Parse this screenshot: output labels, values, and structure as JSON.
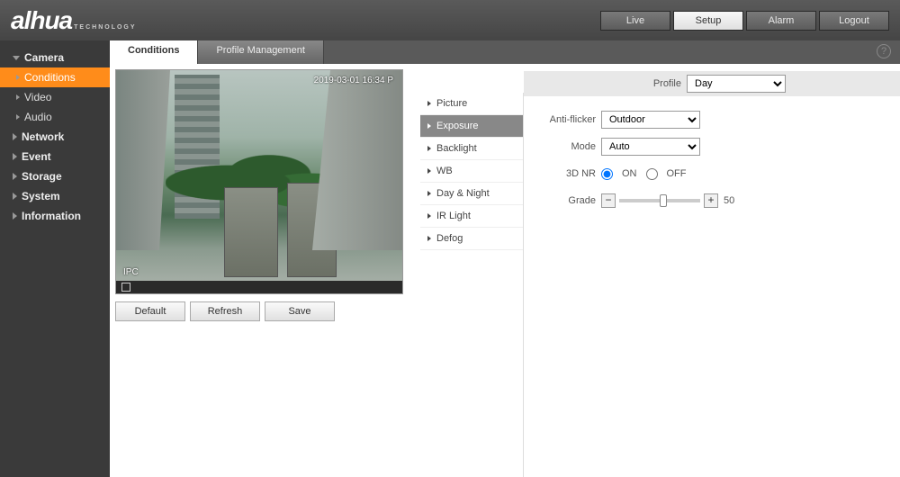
{
  "brand": {
    "name": "alhua",
    "sub": "TECHNOLOGY"
  },
  "topnav": {
    "live": "Live",
    "setup": "Setup",
    "alarm": "Alarm",
    "logout": "Logout"
  },
  "sidebar": {
    "camera": "Camera",
    "conditions": "Conditions",
    "video": "Video",
    "audio": "Audio",
    "network": "Network",
    "event": "Event",
    "storage": "Storage",
    "system": "System",
    "information": "Information"
  },
  "tabs": {
    "conditions": "Conditions",
    "profile_mgmt": "Profile Management"
  },
  "preview": {
    "timestamp": "2019-03-01 16:34 P",
    "label": "IPC"
  },
  "buttons": {
    "default": "Default",
    "refresh": "Refresh",
    "save": "Save"
  },
  "midmenu": {
    "picture": "Picture",
    "exposure": "Exposure",
    "backlight": "Backlight",
    "wb": "WB",
    "day_night": "Day & Night",
    "ir_light": "IR Light",
    "defog": "Defog"
  },
  "settings": {
    "profile_label": "Profile",
    "profile_value": "Day",
    "anti_flicker_label": "Anti-flicker",
    "anti_flicker_value": "Outdoor",
    "mode_label": "Mode",
    "mode_value": "Auto",
    "nr_label": "3D NR",
    "nr_on": "ON",
    "nr_off": "OFF",
    "grade_label": "Grade",
    "grade_value": "50"
  }
}
